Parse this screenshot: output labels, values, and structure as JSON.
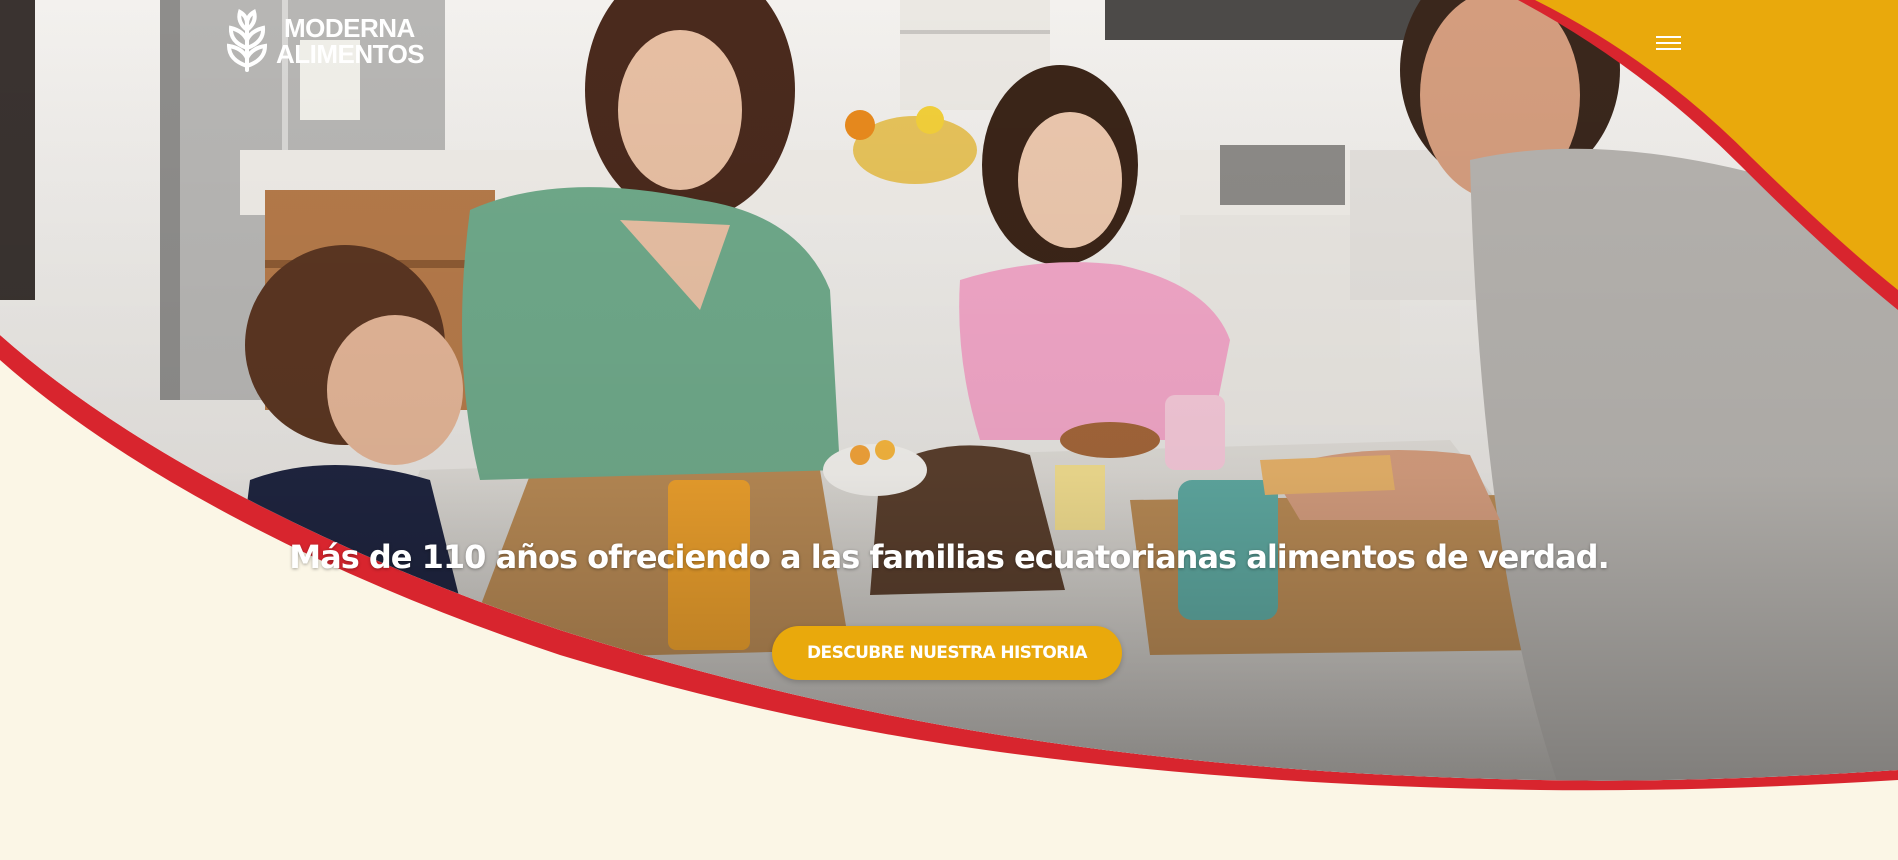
{
  "brand": {
    "name_line1": "MODERNA",
    "name_line2": "ALIMENTOS",
    "logo_icon": "wheat-icon"
  },
  "nav": {
    "menu_icon": "hamburger-menu-icon"
  },
  "hero": {
    "headline": "Más de 110 años ofreciendo a las familias ecuatorianas alimentos de verdad.",
    "cta_label": "DESCUBRE NUESTRA HISTORIA",
    "photo": "family-breakfast-photo"
  },
  "colors": {
    "accent_yellow": "#e9a90c",
    "accent_red": "#d8252e",
    "background_cream": "#fbf6e6"
  }
}
